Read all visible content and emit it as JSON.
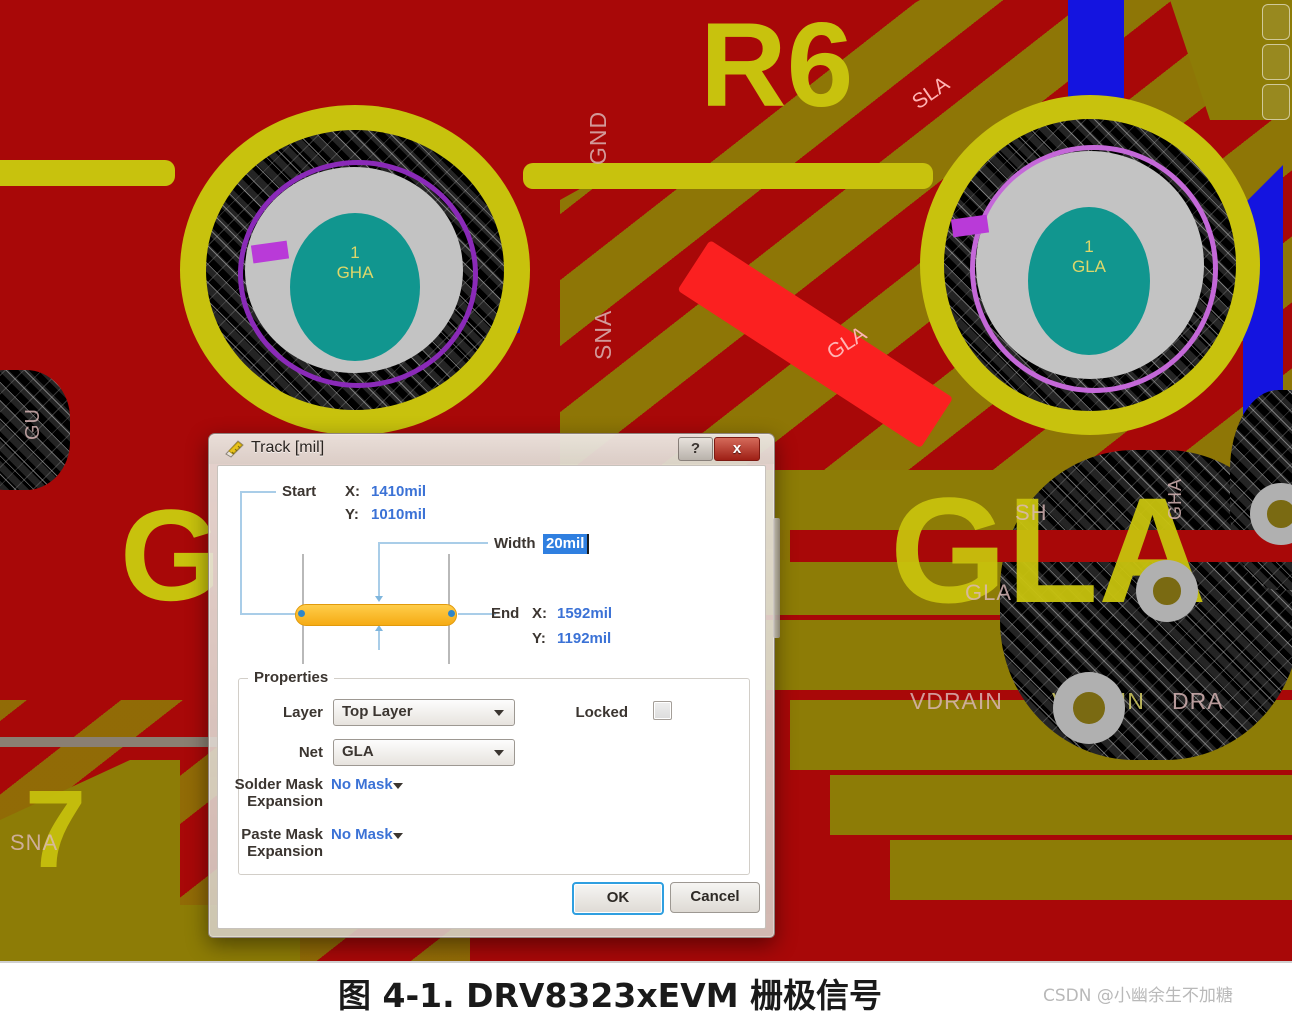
{
  "pcb": {
    "colors": {
      "solder_red": "#a80808",
      "copper_olive": "#8d7c06",
      "silk_yellow": "#c8c20d",
      "bottom_blue": "#1414e0",
      "top_red_track": "#fb2020",
      "pad_metal": "#c3c3c3",
      "hole_teal": "#11968f",
      "multi_purple": "#8a2ab8"
    },
    "designators": [
      {
        "text": "R6"
      },
      {
        "text": "7"
      },
      {
        "text": "GLA"
      },
      {
        "text": "G"
      }
    ],
    "pads": [
      {
        "number": "1",
        "net": "GHA"
      },
      {
        "number": "1",
        "net": "GLA"
      }
    ],
    "net_labels": [
      {
        "text": "GND"
      },
      {
        "text": "SNA"
      },
      {
        "text": "SLA"
      },
      {
        "text": "GLA"
      },
      {
        "text": "SNA"
      },
      {
        "text": "SHA"
      },
      {
        "text": "GHA"
      },
      {
        "text": "GLA"
      },
      {
        "text": "VDRAIN"
      },
      {
        "text": "VDRAIN"
      },
      {
        "text": "DRA"
      },
      {
        "text": "GHA"
      },
      {
        "text": "SH"
      },
      {
        "text": "GU"
      }
    ]
  },
  "dialog": {
    "title": "Track [mil]",
    "icon": "track-ruler-icon",
    "help_label": "?",
    "close_label": "x",
    "geometry": {
      "start_label": "Start",
      "start_x_label": "X:",
      "start_x_value": "1410mil",
      "start_y_label": "Y:",
      "start_y_value": "1010mil",
      "width_label": "Width",
      "width_value": "20mil",
      "end_label": "End",
      "end_x_label": "X:",
      "end_x_value": "1592mil",
      "end_y_label": "Y:",
      "end_y_value": "1192mil"
    },
    "properties": {
      "legend": "Properties",
      "layer_label": "Layer",
      "layer_value": "Top Layer",
      "net_label": "Net",
      "net_value": "GLA",
      "locked_label": "Locked",
      "locked_checked": false,
      "solder_mask_label_1": "Solder Mask",
      "solder_mask_label_2": "Expansion",
      "solder_mask_value": "No Mask",
      "paste_mask_label_1": "Paste Mask",
      "paste_mask_label_2": "Expansion",
      "paste_mask_value": "No Mask"
    },
    "buttons": {
      "ok": "OK",
      "cancel": "Cancel"
    }
  },
  "caption": {
    "text": "图 4-1. DRV8323xEVM 栅极信号",
    "watermark": "CSDN @小幽余生不加糖"
  }
}
